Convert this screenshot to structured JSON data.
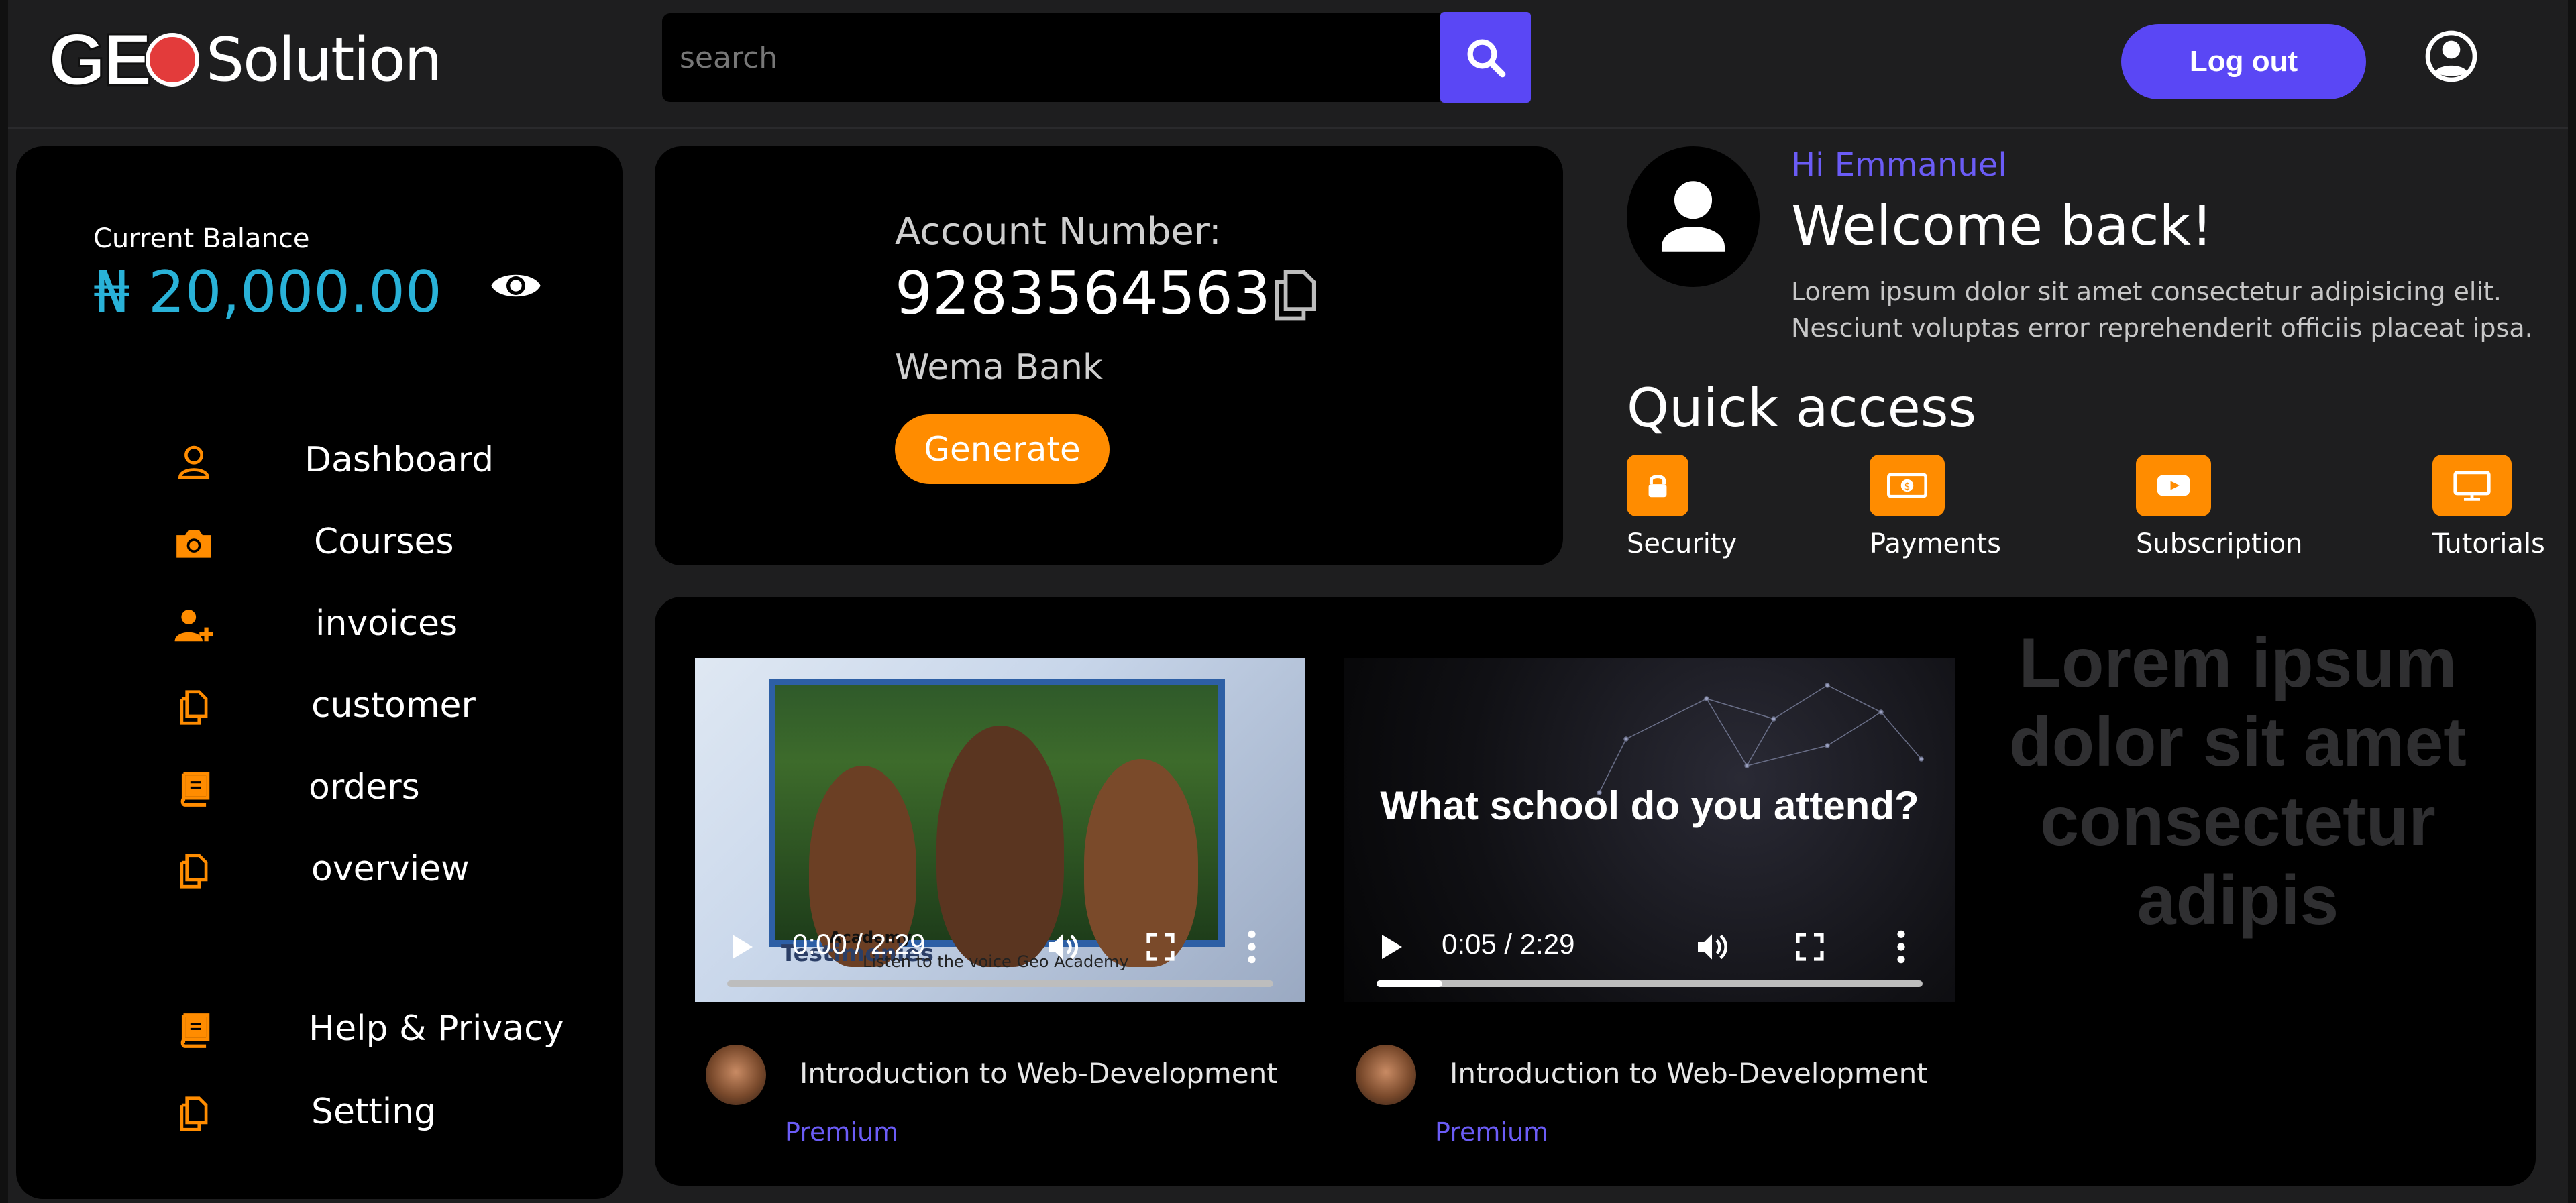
{
  "header": {
    "logo_text": "GEOSolution",
    "search_placeholder": "search",
    "logout_label": "Log out"
  },
  "balance": {
    "label": "Current Balance",
    "value": "₦ 20,000.00"
  },
  "sidebar": {
    "items": [
      {
        "label": "Dashboard",
        "icon": "user-icon"
      },
      {
        "label": "Courses",
        "icon": "camera-icon"
      },
      {
        "label": "invoices",
        "icon": "user-plus-icon"
      },
      {
        "label": "customer",
        "icon": "copy-icon"
      },
      {
        "label": "orders",
        "icon": "book-icon"
      },
      {
        "label": "overview",
        "icon": "copy-icon"
      },
      {
        "label": "Help & Privacy",
        "icon": "book-icon"
      },
      {
        "label": "Setting",
        "icon": "copy-icon"
      }
    ]
  },
  "account": {
    "label": "Account Number:",
    "number": "9283564563",
    "bank": "Wema Bank",
    "generate_label": "Generate"
  },
  "welcome": {
    "greeting": "Hi Emmanuel",
    "title": "Welcome back!",
    "text": "Lorem ipsum dolor sit amet consectetur adipisicing elit. Nesciunt voluptas error reprehenderit officiis placeat ipsa."
  },
  "quick_access": {
    "title": "Quick access",
    "items": [
      {
        "label": "Security",
        "icon": "lock-icon"
      },
      {
        "label": "Payments",
        "icon": "money-icon"
      },
      {
        "label": "Subscription",
        "icon": "youtube-icon"
      },
      {
        "label": "Tutorials",
        "icon": "monitor-icon"
      }
    ]
  },
  "videos": [
    {
      "time": "0:00 / 2:29",
      "progress": 0.0,
      "overlay_brand": "Academy",
      "overlay_title": "Testimonies",
      "overlay_caption": "Listen to the voice Geo Academy",
      "course_title": "Introduction to Web-Development",
      "tag": "Premium"
    },
    {
      "title": "What school do you attend?",
      "time": "0:05 / 2:29",
      "progress": 0.12,
      "course_title": "Introduction to Web-Development",
      "tag": "Premium"
    }
  ],
  "ghost_text": "Lorem ipsum dolor sit amet consectetur adipis",
  "colors": {
    "accent": "#5a47f5",
    "orange": "#ff8c00",
    "balance": "#29b2d8",
    "greeting": "#6b5cf6"
  }
}
